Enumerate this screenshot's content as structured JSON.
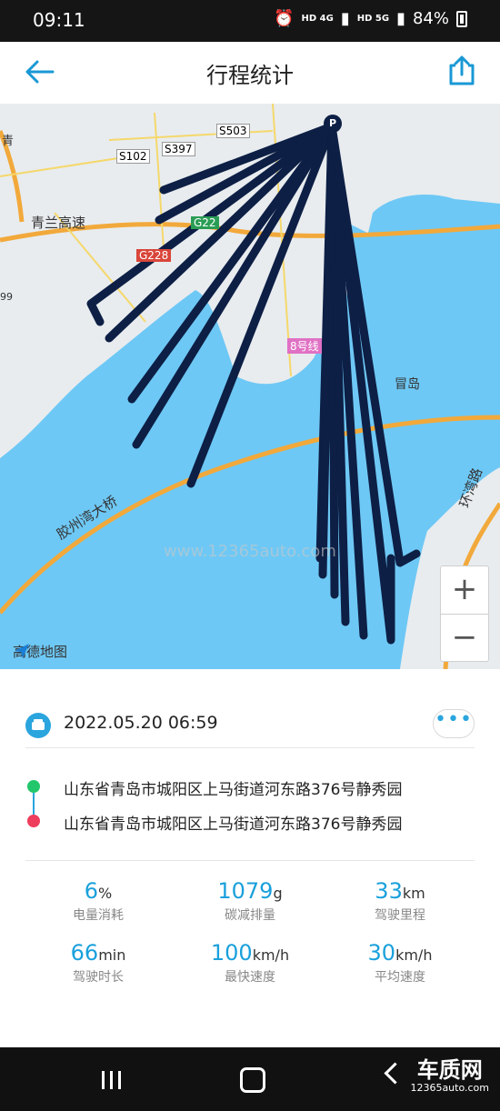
{
  "status_bar": {
    "time": "09:11",
    "network": "HD 4G",
    "network2": "HD 5G",
    "battery": "84%"
  },
  "header": {
    "title": "行程统计",
    "back_icon": "arrow-left-icon",
    "share_icon": "share-icon"
  },
  "map": {
    "labels": {
      "road1": "青兰高速",
      "s102": "S102",
      "s397": "S397",
      "s503": "S503",
      "g22": "G22",
      "g228": "G228",
      "line8": "8号线",
      "maodao": "冒岛",
      "bridge": "胶州湾大桥",
      "huanwan": "环湾路",
      "left_edge": "青",
      "ninety_nine": "99"
    },
    "logo": "高德地图",
    "watermark": "www.12365auto.com",
    "parking_marker": "P",
    "zoom_in": "+",
    "zoom_out": "−",
    "colors": {
      "water": "#6ec8f5",
      "land": "#e8ecef",
      "route": "#0d1f45",
      "highway": "#f2a93b"
    }
  },
  "trip": {
    "datetime": "2022.05.20 06:59",
    "more": "•••",
    "start_address": "山东省青岛市城阳区上马街道河东路376号静秀园",
    "end_address": "山东省青岛市城阳区上马街道河东路376号静秀园"
  },
  "stats": [
    {
      "value": "6",
      "unit": "%",
      "label": "电量消耗"
    },
    {
      "value": "1079",
      "unit": "g",
      "label": "碳减排量"
    },
    {
      "value": "33",
      "unit": "km",
      "label": "驾驶里程"
    },
    {
      "value": "66",
      "unit": "min",
      "label": "驾驶时长"
    },
    {
      "value": "100",
      "unit": "km/h",
      "label": "最快速度"
    },
    {
      "value": "30",
      "unit": "km/h",
      "label": "平均速度"
    }
  ],
  "nav": {
    "brand_main": "车质网",
    "brand_sub": "12365auto.com"
  }
}
